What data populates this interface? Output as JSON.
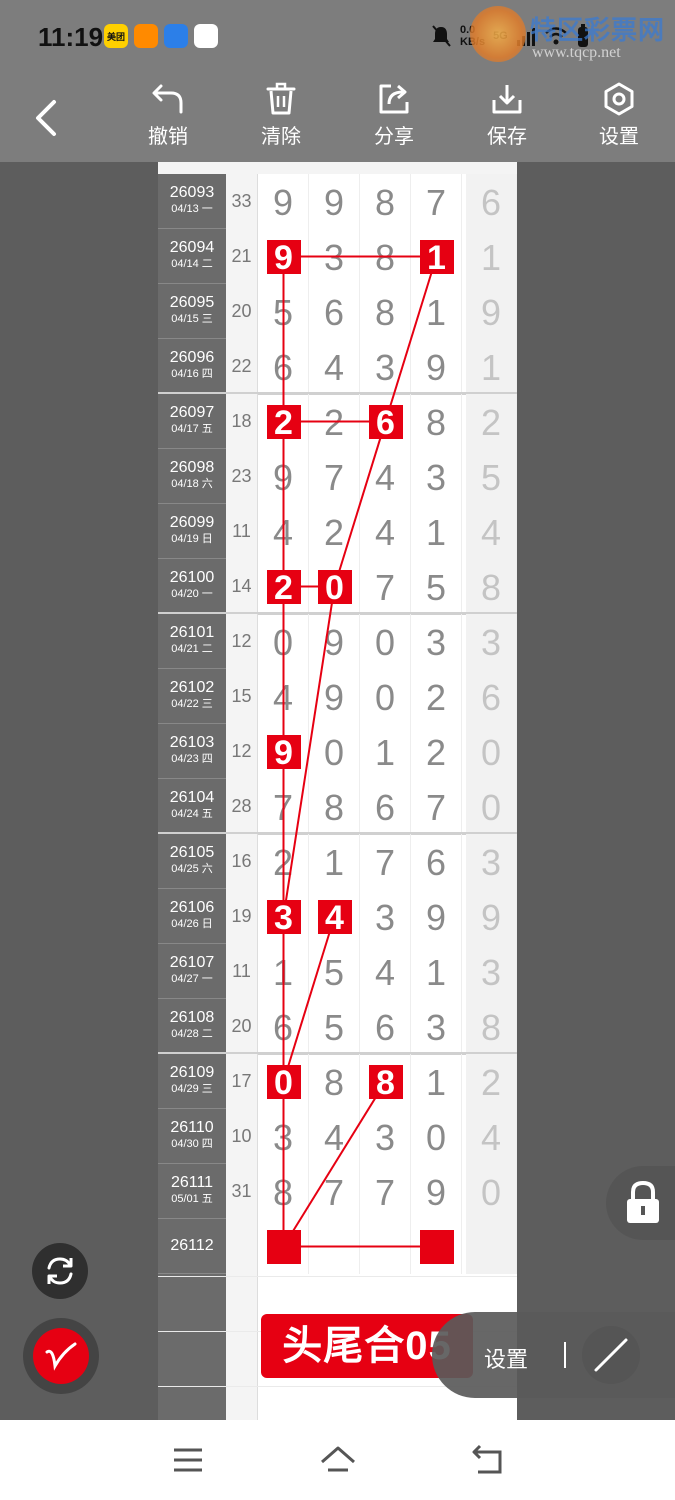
{
  "status_bar": {
    "time": "11:19",
    "apps": [
      {
        "name": "meituan-app-icon",
        "label": "美团",
        "color": "#ffd000"
      },
      {
        "name": "video-app-icon",
        "label": "",
        "color": "#ff8a00"
      },
      {
        "name": "blue-app-icon",
        "label": "",
        "color": "#2c7fe8"
      },
      {
        "name": "calendar-app-icon",
        "label": "",
        "color": "#ffffff"
      }
    ],
    "speed": "0.0",
    "speed_unit": "KB/s",
    "network": "5G"
  },
  "watermark": {
    "title": "特区彩票网",
    "url": "www.tqcp.net"
  },
  "toolbar": {
    "undo_label": "撤销",
    "clear_label": "清除",
    "share_label": "分享",
    "save_label": "保存",
    "settings_label": "设置"
  },
  "rows": [
    {
      "issue": "26093",
      "date": "04/13 一",
      "sum": "33",
      "digits": [
        "9",
        "9",
        "8",
        "7"
      ],
      "tail": "6"
    },
    {
      "issue": "26094",
      "date": "04/14 二",
      "sum": "21",
      "digits": [
        "9",
        "3",
        "8",
        "1"
      ],
      "tail": "1"
    },
    {
      "issue": "26095",
      "date": "04/15 三",
      "sum": "20",
      "digits": [
        "5",
        "6",
        "8",
        "1"
      ],
      "tail": "9"
    },
    {
      "issue": "26096",
      "date": "04/16 四",
      "sum": "22",
      "digits": [
        "6",
        "4",
        "3",
        "9"
      ],
      "tail": "1"
    },
    {
      "issue": "26097",
      "date": "04/17 五",
      "sum": "18",
      "digits": [
        "2",
        "2",
        "6",
        "8"
      ],
      "tail": "2"
    },
    {
      "issue": "26098",
      "date": "04/18 六",
      "sum": "23",
      "digits": [
        "9",
        "7",
        "4",
        "3"
      ],
      "tail": "5"
    },
    {
      "issue": "26099",
      "date": "04/19 日",
      "sum": "11",
      "digits": [
        "4",
        "2",
        "4",
        "1"
      ],
      "tail": "4"
    },
    {
      "issue": "26100",
      "date": "04/20 一",
      "sum": "14",
      "digits": [
        "2",
        "0",
        "7",
        "5"
      ],
      "tail": "8"
    },
    {
      "issue": "26101",
      "date": "04/21 二",
      "sum": "12",
      "digits": [
        "0",
        "9",
        "0",
        "3"
      ],
      "tail": "3"
    },
    {
      "issue": "26102",
      "date": "04/22 三",
      "sum": "15",
      "digits": [
        "4",
        "9",
        "0",
        "2"
      ],
      "tail": "6"
    },
    {
      "issue": "26103",
      "date": "04/23 四",
      "sum": "12",
      "digits": [
        "9",
        "0",
        "1",
        "2"
      ],
      "tail": "0"
    },
    {
      "issue": "26104",
      "date": "04/24 五",
      "sum": "28",
      "digits": [
        "7",
        "8",
        "6",
        "7"
      ],
      "tail": "0"
    },
    {
      "issue": "26105",
      "date": "04/25 六",
      "sum": "16",
      "digits": [
        "2",
        "1",
        "7",
        "6"
      ],
      "tail": "3"
    },
    {
      "issue": "26106",
      "date": "04/26 日",
      "sum": "19",
      "digits": [
        "3",
        "4",
        "3",
        "9"
      ],
      "tail": "9"
    },
    {
      "issue": "26107",
      "date": "04/27 一",
      "sum": "11",
      "digits": [
        "1",
        "5",
        "4",
        "1"
      ],
      "tail": "3"
    },
    {
      "issue": "26108",
      "date": "04/28 二",
      "sum": "20",
      "digits": [
        "6",
        "5",
        "6",
        "3"
      ],
      "tail": "8"
    },
    {
      "issue": "26109",
      "date": "04/29 三",
      "sum": "17",
      "digits": [
        "0",
        "8",
        "8",
        "1"
      ],
      "tail": "2"
    },
    {
      "issue": "26110",
      "date": "04/30 四",
      "sum": "10",
      "digits": [
        "3",
        "4",
        "3",
        "0"
      ],
      "tail": "4"
    },
    {
      "issue": "26111",
      "date": "05/01 五",
      "sum": "31",
      "digits": [
        "8",
        "7",
        "7",
        "9"
      ],
      "tail": "0"
    },
    {
      "issue": "26112",
      "date": "",
      "sum": "",
      "digits": [
        "",
        "",
        "",
        ""
      ],
      "tail": ""
    }
  ],
  "highlights": [
    {
      "row": 1,
      "col": 0,
      "value": "9"
    },
    {
      "row": 1,
      "col": 3,
      "value": "1"
    },
    {
      "row": 4,
      "col": 0,
      "value": "2"
    },
    {
      "row": 4,
      "col": 2,
      "value": "6"
    },
    {
      "row": 7,
      "col": 0,
      "value": "2"
    },
    {
      "row": 7,
      "col": 1,
      "value": "0"
    },
    {
      "row": 10,
      "col": 0,
      "value": "9"
    },
    {
      "row": 13,
      "col": 0,
      "value": "3"
    },
    {
      "row": 13,
      "col": 1,
      "value": "4"
    },
    {
      "row": 16,
      "col": 0,
      "value": "0"
    },
    {
      "row": 16,
      "col": 2,
      "value": "8"
    },
    {
      "row": 19,
      "col": 0,
      "value": ""
    },
    {
      "row": 19,
      "col": 3,
      "value": ""
    }
  ],
  "banner_text": "头尾合05",
  "settings_pill": {
    "label": "设置"
  },
  "accent_color": "#e60012"
}
